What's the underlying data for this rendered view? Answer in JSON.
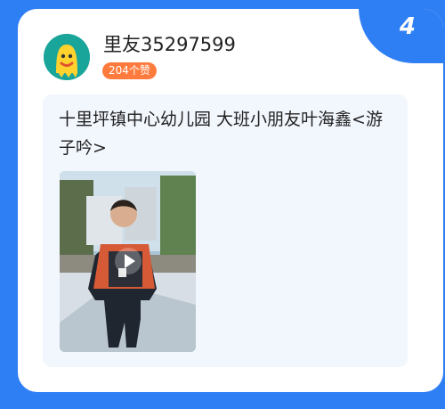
{
  "card": {
    "rank": "4"
  },
  "user": {
    "name": "里友35297599",
    "likes_label": "204个赞",
    "avatar_icon": "yellow-monster-avatar"
  },
  "post": {
    "title": "十里坪镇中心幼儿园 大班小朋友叶海鑫<游子吟>"
  },
  "media": {
    "type": "video",
    "play_icon": "play-icon"
  },
  "colors": {
    "background": "#2f7ff4",
    "badge": "#ff7a3d",
    "content_bg": "#f2f6fd"
  }
}
